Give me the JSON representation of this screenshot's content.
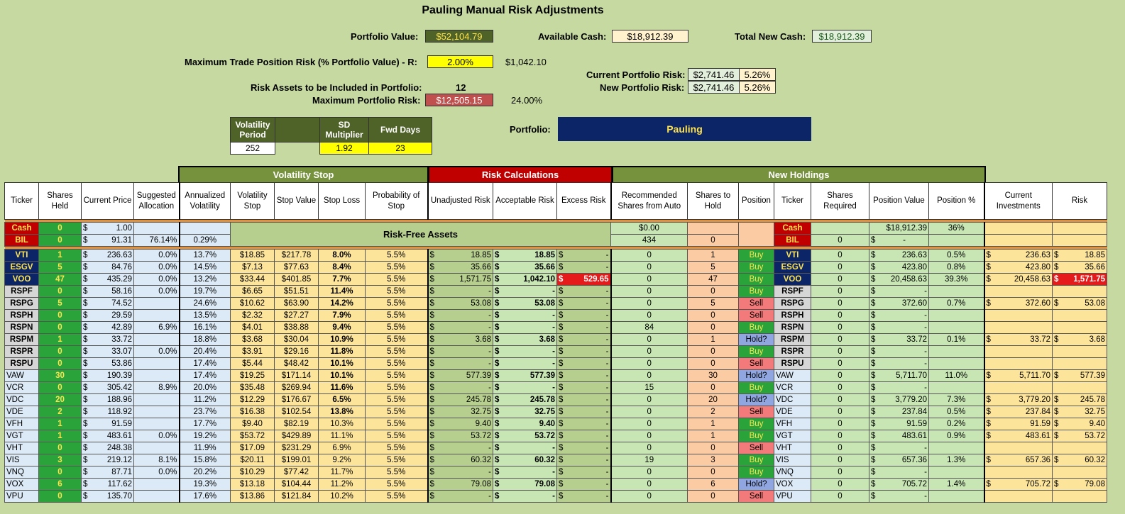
{
  "title": "Pauling Manual Risk Adjustments",
  "summary": {
    "portfolio_value_label": "Portfolio Value:",
    "portfolio_value": "$52,104.79",
    "available_cash_label": "Available Cash:",
    "available_cash": "$18,912.39",
    "total_new_cash_label": "Total New Cash:",
    "total_new_cash": "$18,912.39",
    "max_trade_risk_label": "Maximum Trade Position Risk (% Portfolio Value) - R:",
    "max_trade_risk_pct": "2.00%",
    "max_trade_risk_amt": "$1,042.10",
    "current_risk_label": "Current Portfolio Risk:",
    "current_risk_amt": "$2,741.46",
    "current_risk_pct": "5.26%",
    "new_risk_label": "New Portfolio Risk:",
    "new_risk_amt": "$2,741.46",
    "new_risk_pct": "5.26%",
    "risk_assets_label": "Risk Assets to be Included in Portfolio:",
    "risk_assets": "12",
    "max_portfolio_risk_label": "Maximum Portfolio Risk:",
    "max_portfolio_risk_amt": "$12,505.15",
    "max_portfolio_risk_pct": "24.00%",
    "portfolio_label": "Portfolio:",
    "portfolio_name": "Pauling"
  },
  "params": {
    "vol_period_label": "Volatility Period",
    "sd_mult_label": "SD Multiplier",
    "fwd_days_label": "Fwd Days",
    "vol_period": "252",
    "sd_mult": "1.92",
    "fwd_days": "23"
  },
  "sections": {
    "volatility_stop": "Volatility Stop",
    "risk_calc": "Risk Calculations",
    "new_holdings": "New Holdings"
  },
  "headers": [
    "Ticker",
    "Shares Held",
    "Current Price",
    "Suggested Allocation",
    "Annualized Volatility",
    "Volatility Stop",
    "Stop Value",
    "Stop Loss",
    "Probability of Stop",
    "Unadjusted Risk",
    "Acceptable Risk",
    "Excess Risk",
    "Recommended Shares from Auto",
    "Shares to Hold",
    "Position",
    "Ticker",
    "Shares Required",
    "Position Value",
    "Position %",
    "Current Investments",
    "Risk"
  ],
  "risk_free_label": "Risk-Free Assets",
  "cash_row": {
    "ticker": "Cash",
    "shares": "0",
    "price": "1.00",
    "rec": "$0.00",
    "ticker2": "Cash",
    "posval": "$18,912.39",
    "pospct": "36%"
  },
  "bil_row": {
    "ticker": "BIL",
    "shares": "0",
    "price": "91.31",
    "alloc": "76.14%",
    "vol": "0.29%",
    "rec": "434",
    "hold": "0",
    "ticker2": "BIL",
    "req": "0",
    "posval": "-"
  },
  "rows": [
    {
      "t": "VTI",
      "s": "1",
      "p": "236.63",
      "a": "0.0%",
      "v": "13.7%",
      "vs": "$18.85",
      "sv": "$217.78",
      "sl": "8.0%",
      "ps": "5.5%",
      "ur": "18.85",
      "ar": "18.85",
      "er": "-",
      "rec": "0",
      "h": "1",
      "pos": "Buy",
      "req": "0",
      "pv": "236.63",
      "pp": "0.5%",
      "ci": "236.63",
      "rk": "18.85",
      "tc": "tk",
      "slb": "b"
    },
    {
      "t": "ESGV",
      "s": "5",
      "p": "84.76",
      "a": "0.0%",
      "v": "14.5%",
      "vs": "$7.13",
      "sv": "$77.63",
      "sl": "8.4%",
      "ps": "5.5%",
      "ur": "35.66",
      "ar": "35.66",
      "er": "-",
      "rec": "0",
      "h": "5",
      "pos": "Buy",
      "req": "0",
      "pv": "423.80",
      "pp": "0.8%",
      "ci": "423.80",
      "rk": "35.66",
      "tc": "tk",
      "slb": "b"
    },
    {
      "t": "VOO",
      "s": "47",
      "p": "435.29",
      "a": "0.0%",
      "v": "13.2%",
      "vs": "$33.44",
      "sv": "$401.85",
      "sl": "7.7%",
      "ps": "5.5%",
      "ur": "1,571.75",
      "ar": "1,042.10",
      "er": "529.65",
      "rec": "0",
      "h": "47",
      "pos": "Buy",
      "req": "0",
      "pv": "20,458.63",
      "pp": "39.3%",
      "ci": "20,458.63",
      "rk": "1,571.75",
      "tc": "tk",
      "slb": "b",
      "exred": true
    },
    {
      "t": "RSPF",
      "s": "0",
      "p": "58.16",
      "a": "0.0%",
      "v": "19.7%",
      "vs": "$6.65",
      "sv": "$51.51",
      "sl": "11.4%",
      "ps": "5.5%",
      "ur": "-",
      "ar": "-",
      "er": "-",
      "rec": "0",
      "h": "0",
      "pos": "Buy",
      "req": "0",
      "pv": "-",
      "pp": "",
      "ci": "",
      "rk": "",
      "tc": "tkg",
      "slb": "b"
    },
    {
      "t": "RSPG",
      "s": "5",
      "p": "74.52",
      "a": "",
      "v": "24.6%",
      "vs": "$10.62",
      "sv": "$63.90",
      "sl": "14.2%",
      "ps": "5.5%",
      "ur": "53.08",
      "ar": "53.08",
      "er": "-",
      "rec": "0",
      "h": "5",
      "pos": "Sell",
      "req": "0",
      "pv": "372.60",
      "pp": "0.7%",
      "ci": "372.60",
      "rk": "53.08",
      "tc": "tkg",
      "slb": "b"
    },
    {
      "t": "RSPH",
      "s": "0",
      "p": "29.59",
      "a": "",
      "v": "13.5%",
      "vs": "$2.32",
      "sv": "$27.27",
      "sl": "7.9%",
      "ps": "5.5%",
      "ur": "-",
      "ar": "-",
      "er": "-",
      "rec": "0",
      "h": "0",
      "pos": "Sell",
      "req": "0",
      "pv": "-",
      "pp": "",
      "ci": "",
      "rk": "",
      "tc": "tkg",
      "slb": "b"
    },
    {
      "t": "RSPN",
      "s": "0",
      "p": "42.89",
      "a": "6.9%",
      "v": "16.1%",
      "vs": "$4.01",
      "sv": "$38.88",
      "sl": "9.4%",
      "ps": "5.5%",
      "ur": "-",
      "ar": "-",
      "er": "-",
      "rec": "84",
      "h": "0",
      "pos": "Buy",
      "req": "0",
      "pv": "-",
      "pp": "",
      "ci": "",
      "rk": "",
      "tc": "tkg",
      "slb": "b"
    },
    {
      "t": "RSPM",
      "s": "1",
      "p": "33.72",
      "a": "",
      "v": "18.8%",
      "vs": "$3.68",
      "sv": "$30.04",
      "sl": "10.9%",
      "ps": "5.5%",
      "ur": "3.68",
      "ar": "3.68",
      "er": "-",
      "rec": "0",
      "h": "1",
      "pos": "Hold?",
      "req": "0",
      "pv": "33.72",
      "pp": "0.1%",
      "ci": "33.72",
      "rk": "3.68",
      "tc": "tkg",
      "slb": "b"
    },
    {
      "t": "RSPR",
      "s": "0",
      "p": "33.07",
      "a": "0.0%",
      "v": "20.4%",
      "vs": "$3.91",
      "sv": "$29.16",
      "sl": "11.8%",
      "ps": "5.5%",
      "ur": "-",
      "ar": "-",
      "er": "-",
      "rec": "0",
      "h": "0",
      "pos": "Buy",
      "req": "0",
      "pv": "-",
      "pp": "",
      "ci": "",
      "rk": "",
      "tc": "tkg",
      "slb": "b"
    },
    {
      "t": "RSPU",
      "s": "0",
      "p": "53.86",
      "a": "",
      "v": "17.4%",
      "vs": "$5.44",
      "sv": "$48.42",
      "sl": "10.1%",
      "ps": "5.5%",
      "ur": "-",
      "ar": "-",
      "er": "-",
      "rec": "0",
      "h": "0",
      "pos": "Sell",
      "req": "0",
      "pv": "-",
      "pp": "",
      "ci": "",
      "rk": "",
      "tc": "tkg",
      "slb": "b"
    },
    {
      "t": "VAW",
      "s": "30",
      "p": "190.39",
      "a": "",
      "v": "17.4%",
      "vs": "$19.25",
      "sv": "$171.14",
      "sl": "10.1%",
      "ps": "5.5%",
      "ur": "577.39",
      "ar": "577.39",
      "er": "-",
      "rec": "0",
      "h": "30",
      "pos": "Hold?",
      "req": "0",
      "pv": "5,711.70",
      "pp": "11.0%",
      "ci": "5,711.70",
      "rk": "577.39",
      "tc": "lb",
      "slb": "b"
    },
    {
      "t": "VCR",
      "s": "0",
      "p": "305.42",
      "a": "8.9%",
      "v": "20.0%",
      "vs": "$35.48",
      "sv": "$269.94",
      "sl": "11.6%",
      "ps": "5.5%",
      "ur": "-",
      "ar": "-",
      "er": "-",
      "rec": "15",
      "h": "0",
      "pos": "Buy",
      "req": "0",
      "pv": "-",
      "pp": "",
      "ci": "",
      "rk": "",
      "tc": "lb",
      "slb": "b"
    },
    {
      "t": "VDC",
      "s": "20",
      "p": "188.96",
      "a": "",
      "v": "11.2%",
      "vs": "$12.29",
      "sv": "$176.67",
      "sl": "6.5%",
      "ps": "5.5%",
      "ur": "245.78",
      "ar": "245.78",
      "er": "-",
      "rec": "0",
      "h": "20",
      "pos": "Hold?",
      "req": "0",
      "pv": "3,779.20",
      "pp": "7.3%",
      "ci": "3,779.20",
      "rk": "245.78",
      "tc": "lb",
      "slb": "b"
    },
    {
      "t": "VDE",
      "s": "2",
      "p": "118.92",
      "a": "",
      "v": "23.7%",
      "vs": "$16.38",
      "sv": "$102.54",
      "sl": "13.8%",
      "ps": "5.5%",
      "ur": "32.75",
      "ar": "32.75",
      "er": "-",
      "rec": "0",
      "h": "2",
      "pos": "Sell",
      "req": "0",
      "pv": "237.84",
      "pp": "0.5%",
      "ci": "237.84",
      "rk": "32.75",
      "tc": "lb",
      "slb": "b"
    },
    {
      "t": "VFH",
      "s": "1",
      "p": "91.59",
      "a": "",
      "v": "17.7%",
      "vs": "$9.40",
      "sv": "$82.19",
      "sl": "10.3%",
      "ps": "5.5%",
      "ur": "9.40",
      "ar": "9.40",
      "er": "-",
      "rec": "0",
      "h": "1",
      "pos": "Buy",
      "req": "0",
      "pv": "91.59",
      "pp": "0.2%",
      "ci": "91.59",
      "rk": "9.40",
      "tc": "lb",
      "slb": ""
    },
    {
      "t": "VGT",
      "s": "1",
      "p": "483.61",
      "a": "0.0%",
      "v": "19.2%",
      "vs": "$53.72",
      "sv": "$429.89",
      "sl": "11.1%",
      "ps": "5.5%",
      "ur": "53.72",
      "ar": "53.72",
      "er": "-",
      "rec": "0",
      "h": "1",
      "pos": "Buy",
      "req": "0",
      "pv": "483.61",
      "pp": "0.9%",
      "ci": "483.61",
      "rk": "53.72",
      "tc": "lb",
      "slb": ""
    },
    {
      "t": "VHT",
      "s": "0",
      "p": "248.38",
      "a": "",
      "v": "11.9%",
      "vs": "$17.09",
      "sv": "$231.29",
      "sl": "6.9%",
      "ps": "5.5%",
      "ur": "-",
      "ar": "-",
      "er": "-",
      "rec": "0",
      "h": "0",
      "pos": "Sell",
      "req": "0",
      "pv": "-",
      "pp": "",
      "ci": "",
      "rk": "",
      "tc": "lb",
      "slb": ""
    },
    {
      "t": "VIS",
      "s": "3",
      "p": "219.12",
      "a": "8.1%",
      "v": "15.8%",
      "vs": "$20.11",
      "sv": "$199.01",
      "sl": "9.2%",
      "ps": "5.5%",
      "ur": "60.32",
      "ar": "60.32",
      "er": "-",
      "rec": "19",
      "h": "3",
      "pos": "Buy",
      "req": "0",
      "pv": "657.36",
      "pp": "1.3%",
      "ci": "657.36",
      "rk": "60.32",
      "tc": "lb",
      "slb": ""
    },
    {
      "t": "VNQ",
      "s": "0",
      "p": "87.71",
      "a": "0.0%",
      "v": "20.2%",
      "vs": "$10.29",
      "sv": "$77.42",
      "sl": "11.7%",
      "ps": "5.5%",
      "ur": "-",
      "ar": "-",
      "er": "-",
      "rec": "0",
      "h": "0",
      "pos": "Buy",
      "req": "0",
      "pv": "-",
      "pp": "",
      "ci": "",
      "rk": "",
      "tc": "lb",
      "slb": ""
    },
    {
      "t": "VOX",
      "s": "6",
      "p": "117.62",
      "a": "",
      "v": "19.3%",
      "vs": "$13.18",
      "sv": "$104.44",
      "sl": "11.2%",
      "ps": "5.5%",
      "ur": "79.08",
      "ar": "79.08",
      "er": "-",
      "rec": "0",
      "h": "6",
      "pos": "Hold?",
      "req": "0",
      "pv": "705.72",
      "pp": "1.4%",
      "ci": "705.72",
      "rk": "79.08",
      "tc": "lb",
      "slb": ""
    },
    {
      "t": "VPU",
      "s": "0",
      "p": "135.70",
      "a": "",
      "v": "17.6%",
      "vs": "$13.86",
      "sv": "$121.84",
      "sl": "10.2%",
      "ps": "5.5%",
      "ur": "-",
      "ar": "-",
      "er": "-",
      "rec": "0",
      "h": "0",
      "pos": "Sell",
      "req": "0",
      "pv": "-",
      "pp": "",
      "ci": "",
      "rk": "",
      "tc": "lb",
      "slb": ""
    }
  ]
}
